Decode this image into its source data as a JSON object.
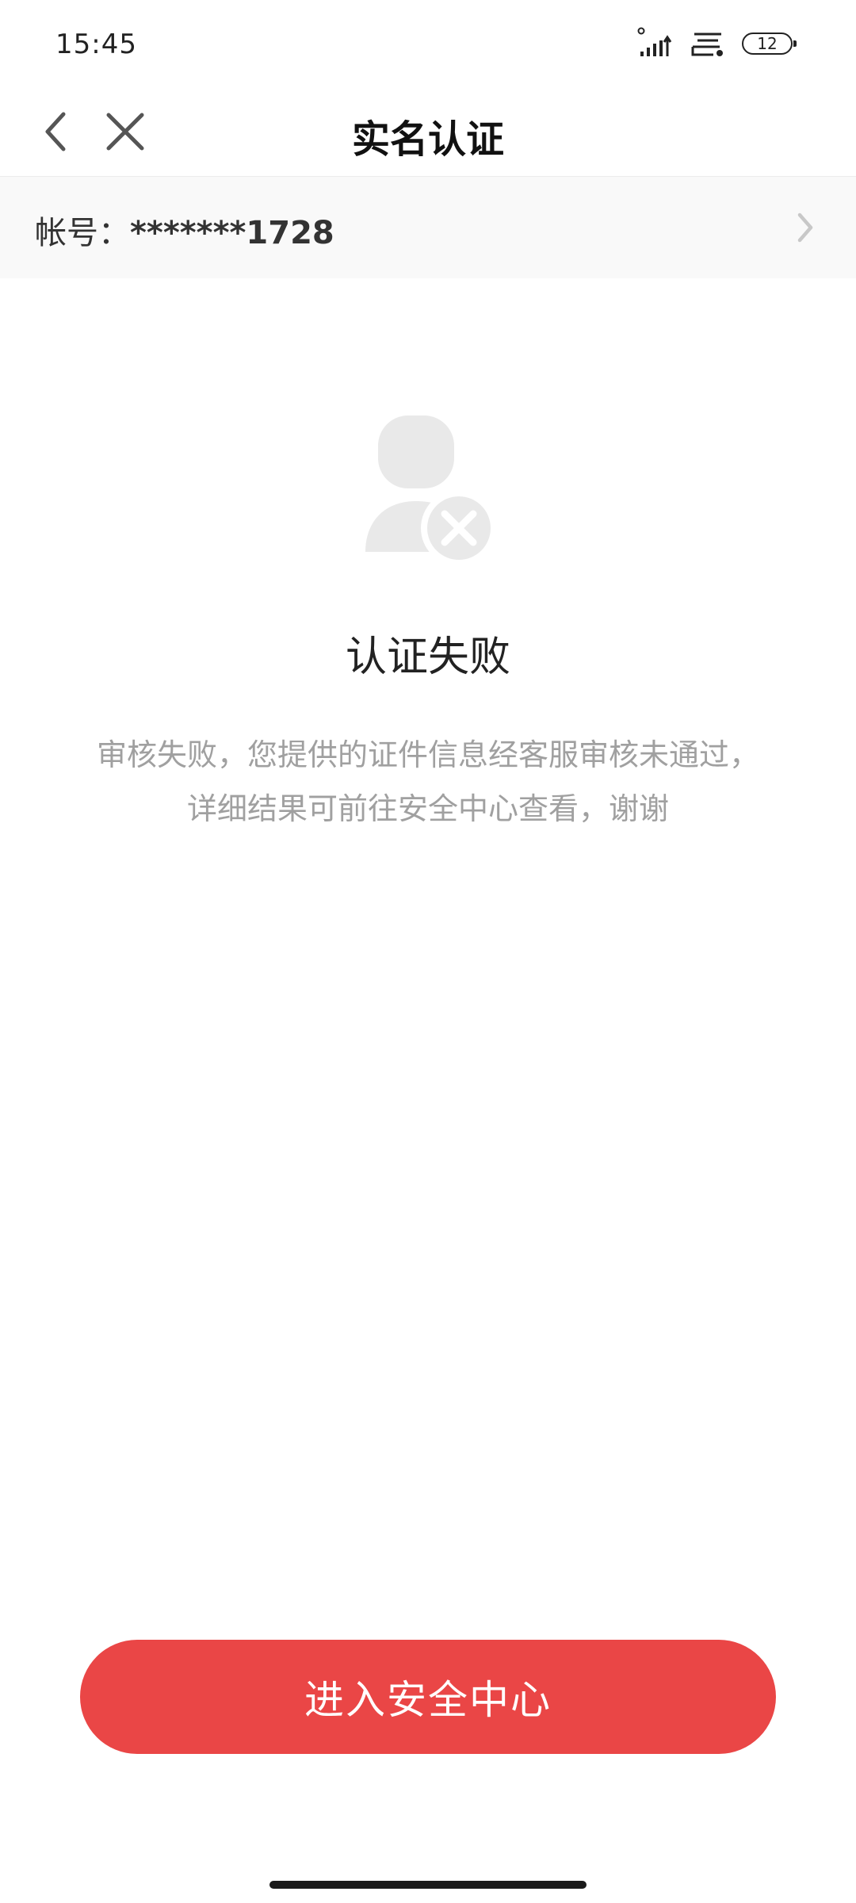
{
  "status_bar": {
    "time": "15:45",
    "battery_level": "12"
  },
  "nav": {
    "title": "实名认证",
    "back_icon": "chevron-left-icon",
    "close_icon": "close-icon"
  },
  "account": {
    "label": "帐号：",
    "value": "*******1728"
  },
  "result": {
    "title": "认证失败",
    "description": "审核失败，您提供的证件信息经客服审核未通过，详细结果可前往安全中心查看，谢谢"
  },
  "actions": {
    "primary_label": "进入安全中心"
  },
  "colors": {
    "accent": "#ea4646",
    "icon_gray": "#e9e9e9",
    "muted_text": "#a0a0a0",
    "account_row_bg": "#f9f9f9"
  }
}
